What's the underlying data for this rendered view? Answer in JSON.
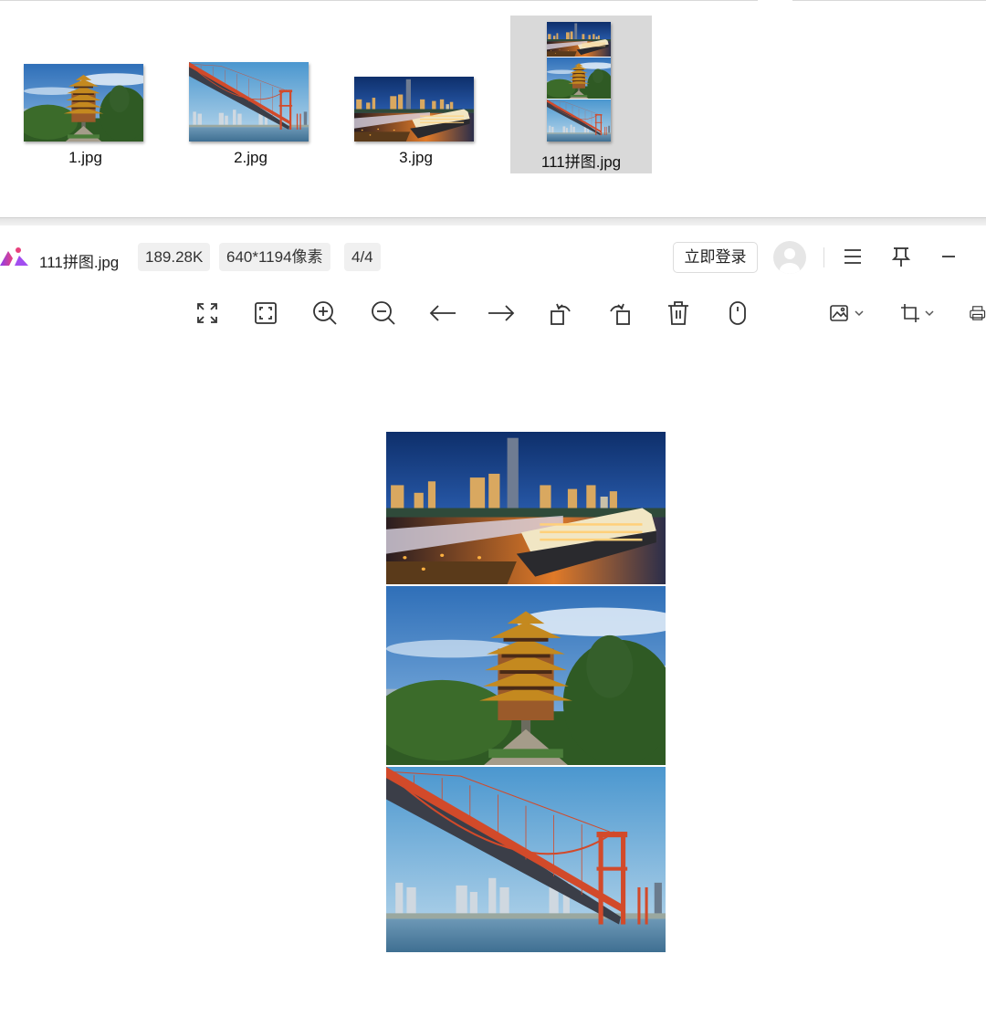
{
  "explorer": {
    "files": [
      {
        "name": "1.jpg",
        "scene": "pagoda"
      },
      {
        "name": "2.jpg",
        "scene": "bridge"
      },
      {
        "name": "3.jpg",
        "scene": "night-harbor"
      },
      {
        "name": "111拼图.jpg",
        "scene": "collage",
        "selected": true
      }
    ]
  },
  "viewer": {
    "title": {
      "filename": "111拼图.jpg",
      "size": "189.28K",
      "dimensions": "640*1194像素",
      "index": "4/4"
    },
    "header": {
      "login_label": "立即登录"
    },
    "toolbar": {
      "icons": [
        "fit-screen-icon",
        "original-size-icon",
        "zoom-in-icon",
        "zoom-out-icon",
        "previous-arrow-icon",
        "next-arrow-icon",
        "rotate-left-icon",
        "rotate-right-icon",
        "delete-icon",
        "mouse-icon",
        "edit-image-icon",
        "crop-icon",
        "print-icon"
      ]
    },
    "colors": {
      "accent_pink": "#e8407c",
      "accent_purple": "#8a3ff0",
      "bridge_red": "#d8462a",
      "sky_blue": "#3b86c6"
    }
  }
}
